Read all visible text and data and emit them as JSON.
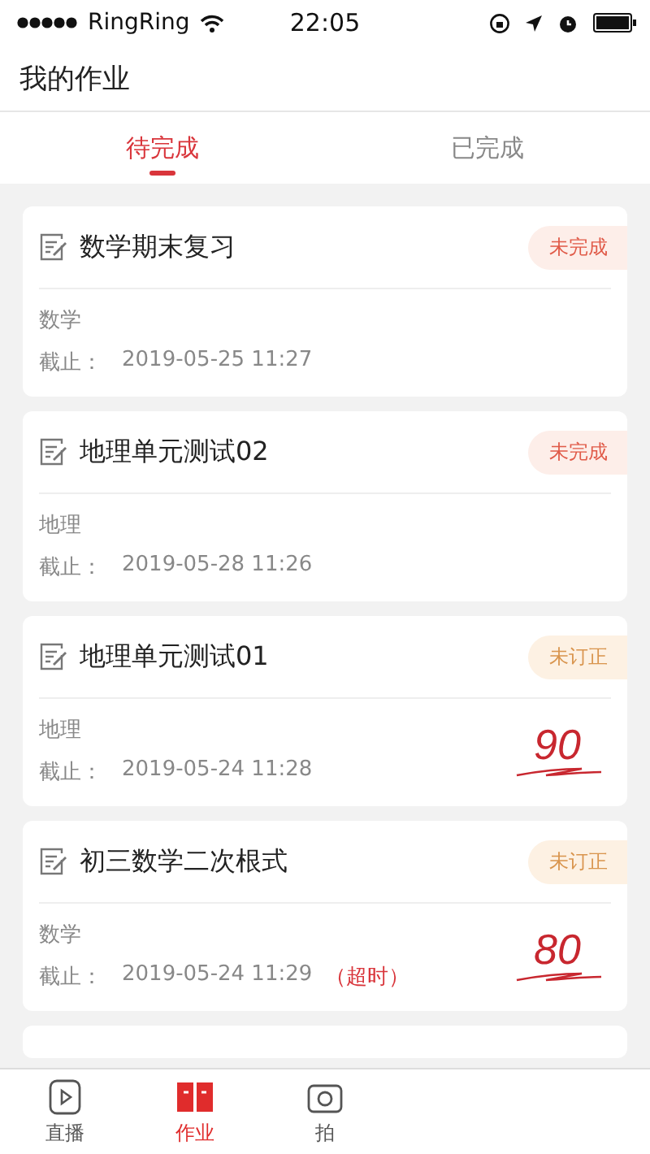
{
  "status_bar": {
    "carrier": "RingRing",
    "time": "22:05"
  },
  "header": {
    "title": "我的作业"
  },
  "tabs": [
    {
      "label": "待完成",
      "selected": true
    },
    {
      "label": "已完成",
      "selected": false
    }
  ],
  "assignments": [
    {
      "title": "数学期末复习",
      "status": {
        "label": "未完成",
        "kind": "incomplete"
      },
      "subject": "数学",
      "deadline_label": "截止：",
      "deadline": "2019-05-25 11:27"
    },
    {
      "title": "地理单元测试02",
      "status": {
        "label": "未完成",
        "kind": "incomplete"
      },
      "subject": "地理",
      "deadline_label": "截止：",
      "deadline": "2019-05-28 11:26"
    },
    {
      "title": "地理单元测试01",
      "status": {
        "label": "未订正",
        "kind": "uncorrected"
      },
      "subject": "地理",
      "deadline_label": "截止：",
      "deadline": "2019-05-24 11:28",
      "score": "90"
    },
    {
      "title": "初三数学二次根式",
      "status": {
        "label": "未订正",
        "kind": "uncorrected"
      },
      "subject": "数学",
      "deadline_label": "截止：",
      "deadline": "2019-05-24 11:29",
      "overdue_note": "（超时）",
      "score": "80"
    }
  ],
  "bottom_nav": [
    {
      "label": "直播",
      "kind": "live",
      "selected": false
    },
    {
      "label": "作业",
      "kind": "homework",
      "selected": true
    },
    {
      "label": "拍",
      "kind": "camera",
      "selected": false
    }
  ]
}
